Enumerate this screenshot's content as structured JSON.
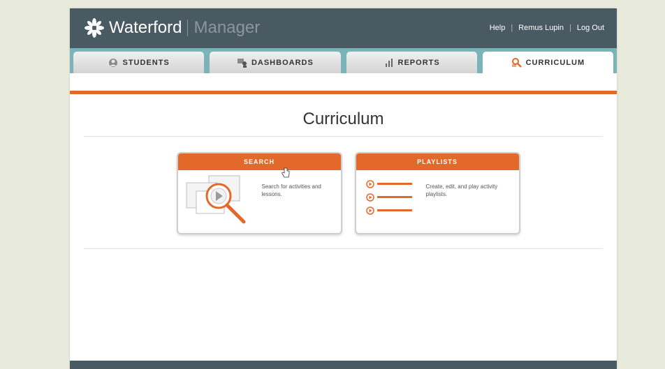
{
  "header": {
    "brand": "Waterford",
    "product": "Manager",
    "nav": {
      "help": "Help",
      "user": "Remus Lupin",
      "logout": "Log Out",
      "divider": "|"
    }
  },
  "tabs": [
    {
      "label": "STUDENTS",
      "icon": "students-icon"
    },
    {
      "label": "DASHBOARDS",
      "icon": "dashboards-icon"
    },
    {
      "label": "REPORTS",
      "icon": "reports-icon"
    },
    {
      "label": "CURRICULUM",
      "icon": "curriculum-icon",
      "active": true
    }
  ],
  "main": {
    "title": "Curriculum"
  },
  "cards": {
    "search": {
      "title": "SEARCH",
      "description": "Search for activities and lessons."
    },
    "playlists": {
      "title": "PLAYLISTS",
      "description": "Create, edit, and play activity playlists."
    }
  },
  "colors": {
    "header_bg": "#4a5a63",
    "tabbar_bg": "#7ab3b8",
    "accent": "#e3692a",
    "page_bg": "#e8ebdc"
  }
}
